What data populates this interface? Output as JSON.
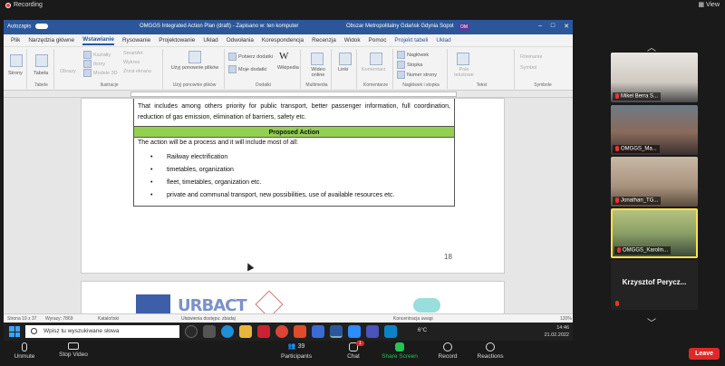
{
  "zoom": {
    "recording_label": "Recording",
    "view_label": "View",
    "toolbar": {
      "unmute": "Unmute",
      "stop_video": "Stop Video",
      "participants": "Participants",
      "participants_count": "39",
      "chat": "Chat",
      "chat_badge": "1",
      "share_screen": "Share Screen",
      "record": "Record",
      "reactions": "Reactions",
      "leave": "Leave"
    },
    "participants": [
      {
        "name": "Mikel Berra S..."
      },
      {
        "name": "OMGGS_Ma..."
      },
      {
        "name": "Jonathan_TG..."
      },
      {
        "name": "OMGGS_Karolin..."
      },
      {
        "name": "Krzysztof Perycz...",
        "display": "Krzysztof  Perycz..."
      }
    ]
  },
  "word": {
    "autosave_label": "Autozapis",
    "doc_title": "OMGGS Integrated Action Plan (draft) - Zapisano w: ten komputer",
    "org": "Obszar Metropolitalny Gdańsk Gdynia Sopot",
    "user_initials": "OM",
    "menu": [
      "Plik",
      "Narzędzia główne",
      "Wstawianie",
      "Rysowanie",
      "Projektowanie",
      "Układ",
      "Odwołania",
      "Korespondencja",
      "Recenzja",
      "Widok",
      "Pomoc",
      "Projekt tabeli",
      "Układ"
    ],
    "active_menu": "Wstawianie",
    "ribbon": {
      "strony": "Strony",
      "tabela": "Tabela",
      "tabele": "Tabele",
      "obrazy": "Obrazy",
      "ksztalty": "Kształty",
      "ikony": "Ikony",
      "modele3d": "Modele 3D",
      "smartart": "SmartArt",
      "wykres": "Wykres",
      "zrzut": "Zrzut ekranu",
      "ilustracje": "Ilustracje",
      "uzyj_ponownie": "Użyj ponownie plików",
      "uzyj_group": "Użyj ponownie plików",
      "pobierz": "Pobierz dodatki",
      "moje_dodatki": "Moje dodatki",
      "wikipedia": "Wikipedia",
      "dodatki": "Dodatki",
      "wideo": "Wideo online",
      "multimedia": "Multimedia",
      "linki": "Linki",
      "komentarz": "Komentarz",
      "komentarze": "Komentarze",
      "naglowek": "Nagłówek",
      "stopka": "Stopka",
      "numer": "Numer strony",
      "naglowek_group": "Nagłówek i stopka",
      "pole": "Pole tekstowe",
      "tekst": "Tekst",
      "rownanie": "Równanie",
      "symbol": "Symbol",
      "symbole": "Symbole"
    },
    "doc": {
      "intro": "That includes  among others priority for public transport, better passenger information, full coordination, reduction of gas emission, elimination of barriers, safety etc.",
      "heading": "Proposed Action",
      "lead": "The action will be a process and it will include most of all:",
      "bullets": [
        "Railway electrification",
        " timetables, organization",
        "fleet, timetables, organization etc.",
        "private and communal transport, new possibilities, use of available resources etc."
      ],
      "page_number": "18",
      "logo_text": "URBACT"
    },
    "status": {
      "page": "Strona 19 z 37",
      "words": "Wyrazy: 7869",
      "lang": "Kataloński",
      "access": "Ułatwienia dostępu: zbadaj",
      "focus": "Koncentracja uwagi",
      "zoom": "120%"
    }
  },
  "taskbar": {
    "search_placeholder": "Wpisz tu wyszukiwane słowa",
    "temperature": "6°C",
    "time": "14:46",
    "date": "21.02.2022"
  }
}
